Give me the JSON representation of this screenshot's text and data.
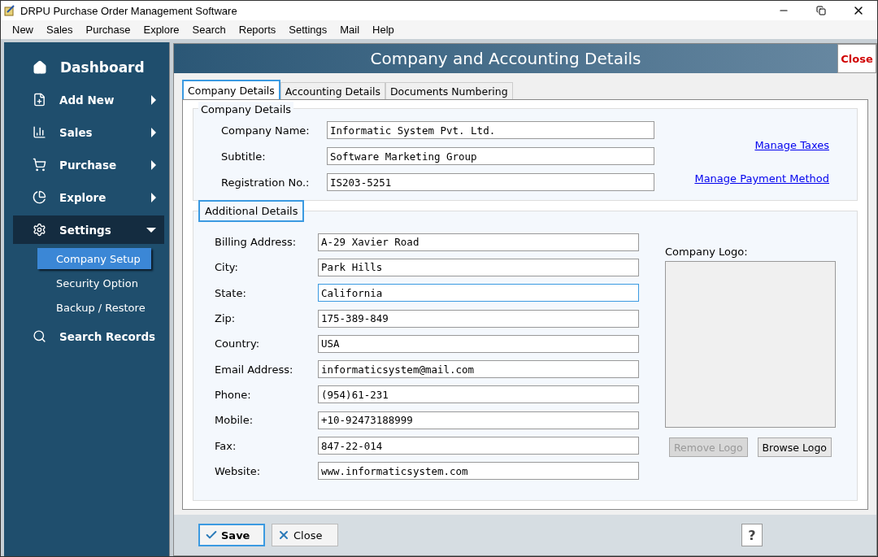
{
  "window": {
    "title": "DRPU Purchase Order Management Software"
  },
  "menu": [
    "New",
    "Sales",
    "Purchase",
    "Explore",
    "Search",
    "Reports",
    "Settings",
    "Mail",
    "Help"
  ],
  "sidebar": {
    "title": "Dashboard",
    "items": [
      {
        "label": "Add New",
        "kind": "add",
        "expanded": false
      },
      {
        "label": "Sales",
        "kind": "chart",
        "expanded": false
      },
      {
        "label": "Purchase",
        "kind": "cart",
        "expanded": false
      },
      {
        "label": "Explore",
        "kind": "pie",
        "expanded": false
      },
      {
        "label": "Settings",
        "kind": "gear",
        "expanded": true,
        "children": [
          {
            "label": "Company Setup",
            "selected": true
          },
          {
            "label": "Security Option",
            "selected": false
          },
          {
            "label": "Backup / Restore",
            "selected": false
          }
        ]
      },
      {
        "label": "Search Records",
        "kind": "search"
      }
    ]
  },
  "panel": {
    "title": "Company and Accounting Details",
    "close": "Close"
  },
  "tabs": [
    {
      "label": "Company Details",
      "selected": true
    },
    {
      "label": "Accounting Details",
      "selected": false
    },
    {
      "label": "Documents Numbering",
      "selected": false
    }
  ],
  "company_group": {
    "title": "Company Details",
    "fields": [
      {
        "label": "Company Name:",
        "value": "Informatic System Pvt. Ltd.",
        "focused": false
      },
      {
        "label": "Subtitle:",
        "value": "Software Marketing Group",
        "focused": false
      },
      {
        "label": "Registration No.:",
        "value": "IS203-5251",
        "focused": false
      }
    ],
    "links": [
      "Manage Taxes",
      "Manage Payment Method"
    ]
  },
  "additional_group": {
    "title": "Additional Details",
    "fields": [
      {
        "label": "Billing Address:",
        "value": "A-29 Xavier Road",
        "focused": false
      },
      {
        "label": "City:",
        "value": "Park Hills",
        "focused": false
      },
      {
        "label": "State:",
        "value": "California",
        "focused": true
      },
      {
        "label": "Zip:",
        "value": "175-389-849",
        "focused": false
      },
      {
        "label": "Country:",
        "value": "USA",
        "focused": false
      },
      {
        "label": "Email Address:",
        "value": "informaticsystem@mail.com",
        "focused": false
      },
      {
        "label": "Phone:",
        "value": "(954)61-231",
        "focused": false
      },
      {
        "label": "Mobile:",
        "value": "+10-92473188999",
        "focused": false
      },
      {
        "label": "Fax:",
        "value": "847-22-014",
        "focused": false
      },
      {
        "label": "Website:",
        "value": "www.informaticsystem.com",
        "focused": false
      }
    ],
    "logo": {
      "label": "Company Logo:",
      "buttons": [
        {
          "label": "Remove Logo",
          "disabled": true
        },
        {
          "label": "Browse Logo",
          "disabled": false
        }
      ]
    }
  },
  "footer": {
    "buttons": [
      {
        "label": "Save",
        "kind": "save",
        "focused": true
      },
      {
        "label": "Close",
        "kind": "close",
        "focused": false
      }
    ],
    "help": "?"
  }
}
